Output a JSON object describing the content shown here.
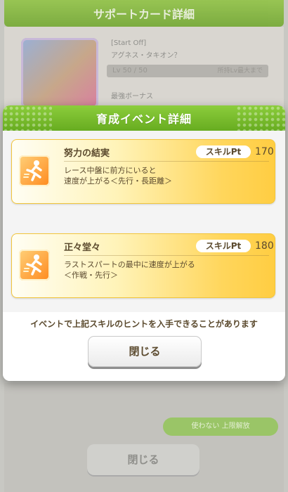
{
  "background": {
    "header_title": "サポートカード詳細",
    "card_line1": "[Start Off]",
    "card_line2": "アグネス・タキオン？",
    "level": "Lv 50 / 50",
    "level_right": "所持Lv最大まで",
    "sub_label": "最強ボーナス",
    "green_button": "使わない 上限解放",
    "close_label": "閉じる"
  },
  "modal": {
    "title": "育成イベント詳細",
    "skills": [
      {
        "name": "努力の結実",
        "pt_label": "スキルPt",
        "pt_value": "170",
        "desc_line1": "レース中盤に前方にいると",
        "desc_line2": "速度が上がる＜先行・長距離＞"
      },
      {
        "name": "正々堂々",
        "pt_label": "スキルPt",
        "pt_value": "180",
        "desc_line1": "ラストスパートの最中に速度が上がる",
        "desc_line2": "＜作戦・先行＞"
      }
    ],
    "notice": "イベントで上記スキルのヒントを入手できることがあります",
    "close_label": "閉じる"
  },
  "colors": {
    "header_green": "#6fb02a",
    "card_gold": "#ffd65c",
    "text_brown": "#5b4a2e"
  },
  "icons": [
    "speed-skill-icon",
    "speed-skill-icon"
  ]
}
